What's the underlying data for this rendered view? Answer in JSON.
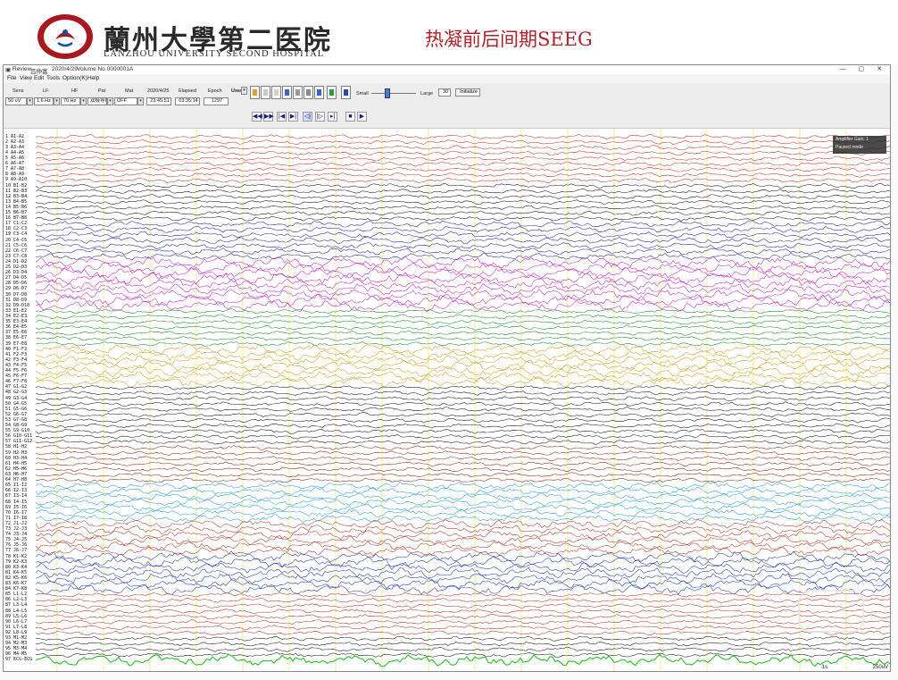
{
  "slide": {
    "hospital_name_cn": "蘭州大學第二医院",
    "hospital_name_en": "LANZHOU UNIVERSITY SECOND HOSPITAL",
    "title": "热凝前后间期SEEG"
  },
  "window": {
    "app_name": "Review",
    "patient": "吕仲富",
    "date": "2020/4/29",
    "volume": "Volume No.0000001A"
  },
  "menu": [
    "File",
    "View",
    "Edit",
    "Tools",
    "Option(K)",
    "Help"
  ],
  "toolbar": {
    "sens_label": "Sens",
    "sens_value": "50 uV",
    "lf_label": "LF",
    "lf_value": "1.6 Hz",
    "hf_label": "HF",
    "hf_value": "70 Hz",
    "pat_label": "Pat",
    "pat_value": "双极导联",
    "mat_label": "Mat",
    "mat_value": "OFF",
    "date_label": "2020/4/25",
    "date_value": "23:45:51",
    "elapsed_label": "Elapsed",
    "elapsed_value": "03:35:14",
    "epoch_label": "Epoch",
    "epoch_value": "1297",
    "user_label": "User",
    "small_label": "Small",
    "large_label": "Large",
    "large_value": "30",
    "initialize_label": "Initialize"
  },
  "overlay": {
    "line1": "Amplifier Gain: 1",
    "line2": "Paused mode"
  },
  "scale_label": "250uV",
  "sec_label": "1s",
  "colors": {
    "group_colors": [
      "#c0392b",
      "#1a1a1a",
      "#23239a",
      "#c226c2",
      "#1f8a2a",
      "#c9a020",
      "#1a1a1a",
      "#8b2a10",
      "#2b9ad6",
      "#b03a2a",
      "#1f3ab0",
      "#b03a2a",
      "#1a1a1a",
      "#28c028"
    ],
    "grid": "#f1e04a"
  },
  "channels": [
    "1  A1-A2",
    "2  A2-A3",
    "3  A3-A4",
    "4  A4-A5",
    "5  A5-A6",
    "6  A6-A7",
    "7  A7-A8",
    "8  A8-A9",
    "9  A9-A10",
    "10 B1-B2",
    "11 B2-B3",
    "12 B3-B4",
    "13 B4-B5",
    "14 B5-B6",
    "15 B6-B7",
    "16 B7-B8",
    "17 C1-C2",
    "18 C2-C3",
    "19 C3-C4",
    "20 C4-C5",
    "21 C5-C6",
    "22 C6-C7",
    "23 C7-C8",
    "24 D1-D2",
    "25 D2-D3",
    "26 D3-D4",
    "27 D4-D5",
    "28 D5-D6",
    "29 D6-D7",
    "30 D7-D8",
    "31 D8-D9",
    "32 D9-D10",
    "33 E1-E2",
    "34 E2-E3",
    "35 E3-E4",
    "36 E4-E5",
    "37 E5-E6",
    "38 E6-E7",
    "39 E7-E8",
    "40 F1-F2",
    "41 F2-F3",
    "42 F3-F4",
    "43 F4-F5",
    "44 F5-F6",
    "45 F6-F7",
    "46 F7-F8",
    "47 G1-G2",
    "48 G2-G3",
    "49 G3-G4",
    "50 G4-G5",
    "51 G5-G6",
    "52 G6-G7",
    "53 G7-G8",
    "54 G8-G9",
    "55 G9-G10",
    "56 G10-G11",
    "57 G11-G12",
    "58 H1-H2",
    "59 H2-H3",
    "60 H3-H4",
    "61 H4-H5",
    "62 H5-H6",
    "63 H6-H7",
    "64 H7-H8",
    "65 I1-I2",
    "66 I2-I3",
    "67 I3-I4",
    "68 I4-I5",
    "69 I5-I6",
    "70 I6-I7",
    "71 I7-I8",
    "72 J1-J2",
    "73 J2-J3",
    "74 J3-J4",
    "75 J4-J5",
    "76 J5-J6",
    "77 J6-J7",
    "78 K1-K2",
    "79 K2-K3",
    "80 K3-K4",
    "81 K4-K5",
    "82 K5-K6",
    "83 K6-K7",
    "84 K7-K8",
    "85 L1-L2",
    "86 L2-L3",
    "87 L3-L4",
    "88 L4-L5",
    "89 L5-L6",
    "90 L6-L7",
    "91 L7-L8",
    "92 L8-L9",
    "93 M1-M2",
    "94 M2-M3",
    "95 M3-M4",
    "96 M4-M5",
    "97 ECG-ECG"
  ]
}
